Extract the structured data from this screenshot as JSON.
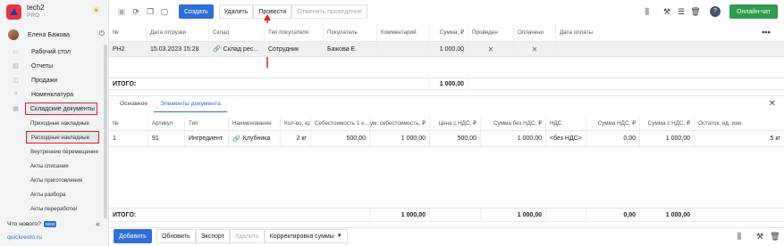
{
  "brand": {
    "name": "tech2",
    "plan": "PRO"
  },
  "user": {
    "name": "Елена Бажова"
  },
  "nav": [
    {
      "label": "Рабочий стол",
      "icon": "dashboard-icon"
    },
    {
      "label": "Отчеты",
      "icon": "reports-icon"
    },
    {
      "label": "Продажи",
      "icon": "sales-icon"
    },
    {
      "label": "Номенклатура",
      "icon": "catalog-icon"
    }
  ],
  "nav_selected": "Складские документы",
  "subnav": [
    "Приходные накладные",
    "Расходные накладные",
    "Внутренние перемещения",
    "Акты списания",
    "Акты приготовления",
    "Акты разбора",
    "Акты переработки"
  ],
  "whatsnew": {
    "label": "Что нового?",
    "badge": "NEW"
  },
  "site": "quickresto.ru",
  "toolbar": {
    "create": "Создать",
    "delete": "Удалить",
    "post": "Провести",
    "unpost": "Отменить проведение",
    "chat": "Онлайн-чат",
    "help": "?"
  },
  "table1": {
    "headers": [
      "№",
      "Дата отгрузки",
      "Склад",
      "Тип покупателя",
      "Покупатель",
      "Комментарий",
      "Сумма, ₽",
      "Проведен",
      "Оплачено",
      "Дата оплаты"
    ],
    "row": {
      "num": "РН2",
      "date": "15.03.2023 15:28",
      "store": "Склад рес...",
      "type": "Сотрудник",
      "buyer": "Бажова Е.",
      "comment": "",
      "sum": "1 000,00",
      "posted": "✕",
      "paid": "✕",
      "paydate": ""
    },
    "total_label": "ИТОГО:",
    "total_sum": "1 000,00"
  },
  "tabs": [
    "Основное",
    "Элементы документа"
  ],
  "table2": {
    "headers": [
      "№",
      "Артикул",
      "Тип",
      "Наименование",
      "Кол-во, ед...",
      "Себестоимость 1 е...",
      "Сум. себестоимость, ₽",
      "Цена с НДС, ₽",
      "Сумма без НДС, ₽",
      "НДС",
      "Сумма НДС, ₽",
      "Сумма с НДС, ₽",
      "Остаток, ед. изм."
    ],
    "row": {
      "num": "1",
      "art": "91",
      "type": "Ингредиент",
      "name": "Клубника",
      "qty": "2 кг",
      "cost1": "500,00",
      "costsum": "1 000,00",
      "price": "500,00",
      "sumnovat": "1 000,00",
      "vat": "<без НДС>",
      "vatsum": "0,00",
      "sumvat": "1 000,00",
      "rest": "5 кг"
    },
    "total_label": "ИТОГО:",
    "totals": {
      "costsum": "1 000,00",
      "sumnovat": "1 000,00",
      "vatsum": "0,00",
      "sumvat": "1 000,00"
    }
  },
  "footer": {
    "add": "Добавить",
    "refresh": "Обновить",
    "export": "Экспорт",
    "delete": "Удалить",
    "adjust": "Корректировка суммы"
  },
  "colors": {
    "accent": "#2f6fd6",
    "chat": "#2e9e4e",
    "highlight": "#e02020"
  }
}
